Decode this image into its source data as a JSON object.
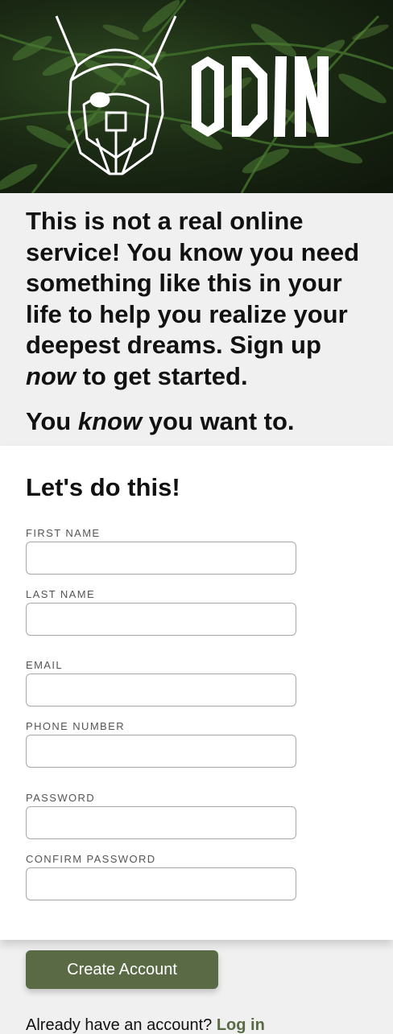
{
  "brand": {
    "name": "ODIN"
  },
  "intro": {
    "p1_part1": "This is not a real online service! You know you need something like this in your life to help you realize your deepest dreams. Sign up ",
    "p1_em": "now",
    "p1_part2": " to get started.",
    "p2_part1": "You ",
    "p2_em": "know",
    "p2_part2": " you want to."
  },
  "form": {
    "heading": "Let's do this!",
    "fields": [
      {
        "label": "First Name",
        "value": ""
      },
      {
        "label": "Last Name",
        "value": ""
      },
      {
        "label": "Email",
        "value": ""
      },
      {
        "label": "Phone Number",
        "value": ""
      },
      {
        "label": "Password",
        "value": ""
      },
      {
        "label": "Confirm Password",
        "value": ""
      }
    ]
  },
  "actions": {
    "create_label": "Create Account",
    "login_prompt": "Already have an account?",
    "login_link": "Log in"
  },
  "colors": {
    "accent": "#596a45",
    "page_bg": "#f0f0f0",
    "card_bg": "#ffffff"
  },
  "icons": {
    "logo": "viking-helmet-icon",
    "background": "fern-leaves-image"
  }
}
